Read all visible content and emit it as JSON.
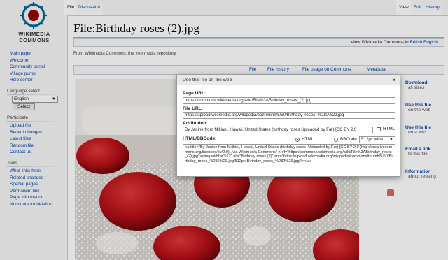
{
  "sidebar": {
    "logo_text": "WIKIMEDIA\nCOMMONS",
    "nav": [
      "Main page",
      "Welcome",
      "Community portal",
      "Village pump",
      "Help center"
    ],
    "language_heading": "Language select",
    "language_value": "English",
    "select_button": "Select",
    "participate_heading": "Participate",
    "participate": [
      "Upload file",
      "Recent changes",
      "Latest files",
      "Random file",
      "Contact us"
    ],
    "tools_heading": "Tools",
    "tools": [
      "What links here",
      "Related changes",
      "Special pages",
      "Permanent link",
      "Page information",
      "Nominate for deletion"
    ]
  },
  "tabs": {
    "left": [
      "File",
      "Discussion"
    ],
    "right": [
      "View",
      "Edit",
      "History"
    ]
  },
  "page": {
    "title": "File:Birthday roses (2).jpg",
    "translated_prefix": "View Wikimedia Commons in ",
    "translated_link": "British English",
    "tagline": "From Wikimedia Commons, the free media repository",
    "file_tabs": [
      "File",
      "File history",
      "File usage on Commons",
      "Metadata"
    ]
  },
  "right_links": [
    {
      "title": "Download",
      "sub": "all sizes"
    },
    {
      "title": "Use this file",
      "sub": "on the web"
    },
    {
      "title": "Use this file",
      "sub": "on a wiki"
    },
    {
      "title": "Email a link",
      "sub": "to this file"
    },
    {
      "title": "Information",
      "sub": "about reusing"
    }
  ],
  "dialog": {
    "title": "Use this file on the web",
    "close": "×",
    "page_url_label": "Page URL:",
    "page_url": "https://commons.wikimedia.org/wiki/File%3ABirthday_roses_(2).jpg",
    "file_url_label": "File URL:",
    "file_url": "https://upload.wikimedia.org/wikipedia/commons/5/50/Birthday_roses_%282%29.jpg",
    "attribution_label": "Attribution:",
    "attribution": "By Janine from Mililani, Hawaii, United States (birthday roses  Uploaded by Fæ) [CC BY 2.0",
    "html_check_label": "HTML",
    "embed_label": "HTML/BBCode:",
    "radio_html": "HTML",
    "radio_bbcode": "BBCode",
    "size": "512px wide",
    "code": "<a title=\"By Janine from Mililani, Hawaii, United States (birthday roses  Uploaded by Fæ) [CC BY 2.0 (http://creativecommons.org/licenses/by/2.0)], via Wikimedia Commons\" href=\"https://commons.wikimedia.org/wiki/File%3ABirthday_roses_(2).jpg\"><img width=\"512\" alt=\"Birthday roses (2)\" src=\"https://upload.wikimedia.org/wikipedia/commons/thumb/5/50/Birthday_roses_%282%29.jpg/512px-Birthday_roses_%282%29.jpg\"/></a>"
  }
}
